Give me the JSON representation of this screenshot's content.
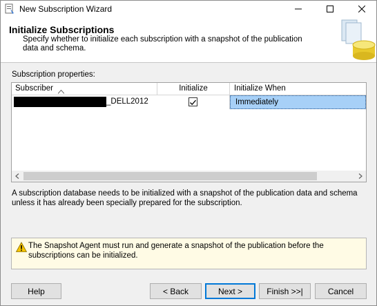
{
  "window": {
    "title": "New Subscription Wizard"
  },
  "header": {
    "title": "Initialize Subscriptions",
    "subtitle": "Specify whether to initialize each subscription with a snapshot of the publication data and schema."
  },
  "grid": {
    "label": "Subscription properties:",
    "columns": [
      "Subscriber",
      "Initialize",
      "Initialize When"
    ],
    "rows": [
      {
        "subscriber_visible": "_DELL2012",
        "initialize": true,
        "initialize_when": "Immediately"
      }
    ]
  },
  "description": "A subscription database needs to be initialized with a snapshot of the publication data and schema unless it has already been specially prepared for the subscription.",
  "warning": "The Snapshot Agent must run and generate a snapshot of the publication before the subscriptions can be initialized.",
  "buttons": {
    "help": "Help",
    "back": "< Back",
    "next": "Next >",
    "finish": "Finish >>|",
    "cancel": "Cancel"
  },
  "colors": {
    "selection": "#a7d0f7",
    "warning_bg": "#fffbe5",
    "default_button_border": "#0078d7"
  }
}
